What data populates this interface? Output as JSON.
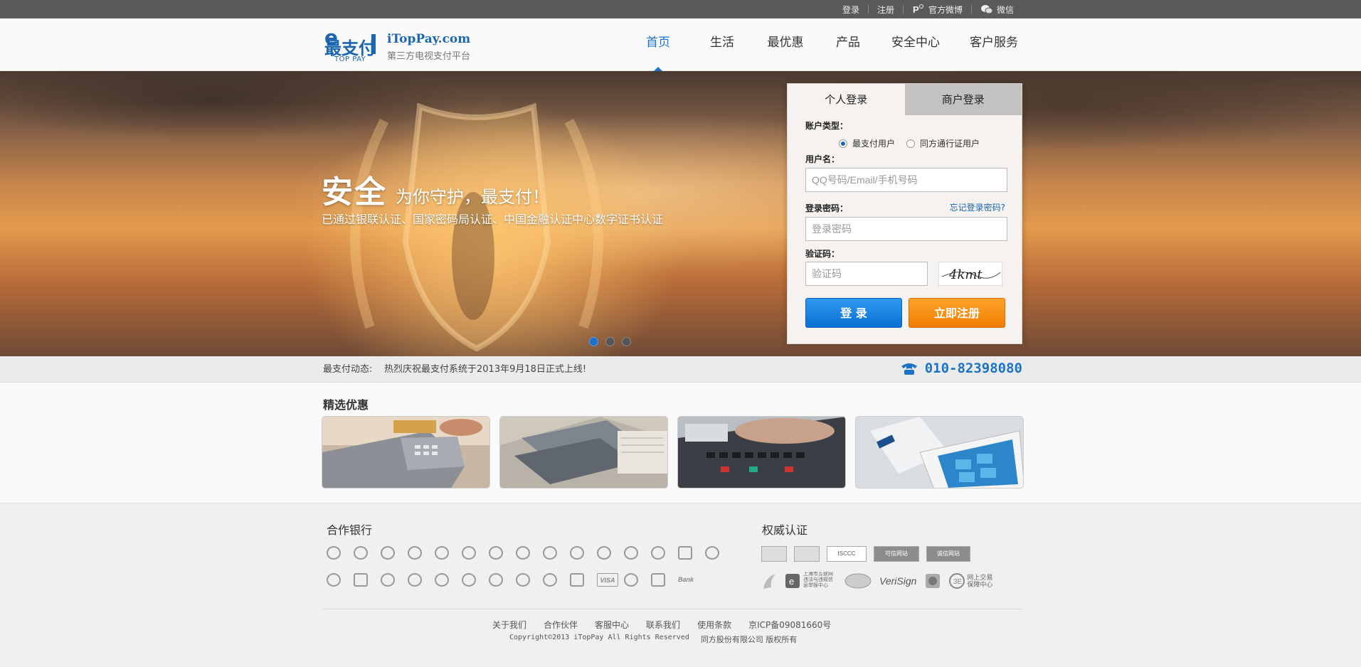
{
  "topbar": {
    "login": "登录",
    "register": "注册",
    "weibo": "官方微博",
    "wechat": "微信"
  },
  "logo": {
    "site": "iTopPay.com",
    "tagline": "第三方电视支付平台",
    "brand_en": "TOP PAY"
  },
  "nav": {
    "items": [
      {
        "label": "首页",
        "active": true
      },
      {
        "label": "生活",
        "active": false
      },
      {
        "label": "最优惠",
        "active": false
      },
      {
        "label": "产品",
        "active": false
      },
      {
        "label": "安全中心",
        "active": false
      },
      {
        "label": "客户服务",
        "active": false
      }
    ]
  },
  "banner": {
    "headline_big": "安全",
    "headline_rest": "为你守护，最支付！",
    "subline": "已通过银联认证、国家密码局认证、中国金融认证中心数字证书认证",
    "slide_count": 3,
    "active_slide": 1
  },
  "login": {
    "tab_personal": "个人登录",
    "tab_merchant": "商户登录",
    "account_type_label": "账户类型：",
    "account_options": [
      "最支付用户",
      "同方通行证用户"
    ],
    "selected_account": 0,
    "username_label": "用户名：",
    "username_placeholder": "QQ号码/Email/手机号码",
    "password_label": "登录密码：",
    "forgot": "忘记登录密码?",
    "password_placeholder": "登录密码",
    "captcha_label": "验证码：",
    "captcha_placeholder": "验证码",
    "captcha_text": "4kmt",
    "login_button": "登 录",
    "register_button": "立即注册"
  },
  "news": {
    "label": "最支付动态:",
    "text": "热烈庆祝最支付系统于2013年9月18日正式上线!",
    "phone": "010-82398080"
  },
  "deals": {
    "title": "精选优惠",
    "cards": [
      {
        "name": "pos-terminal-card"
      },
      {
        "name": "credit-cards"
      },
      {
        "name": "calculator-keypad"
      },
      {
        "name": "phone-card-reader"
      }
    ]
  },
  "footer": {
    "banks_title": "合作银行",
    "cert_title": "权威认证",
    "cert_labels": [
      "ISCCC",
      "可信网站",
      "诚信网站",
      "上海市互联网违法与违规信息举报中心",
      "VeriSign",
      "网上交易保障中心"
    ],
    "links": [
      "关于我们",
      "合作伙伴",
      "客服中心",
      "联系我们",
      "使用条款",
      "京ICP备09081660号"
    ],
    "copyright": "Copyright©2013 iTopPay All Rights Reserved",
    "company": "同方股份有限公司 版权所有"
  },
  "colors": {
    "accent": "#1a73c8",
    "register": "#f07c00",
    "topbar": "#5a5a5a"
  }
}
